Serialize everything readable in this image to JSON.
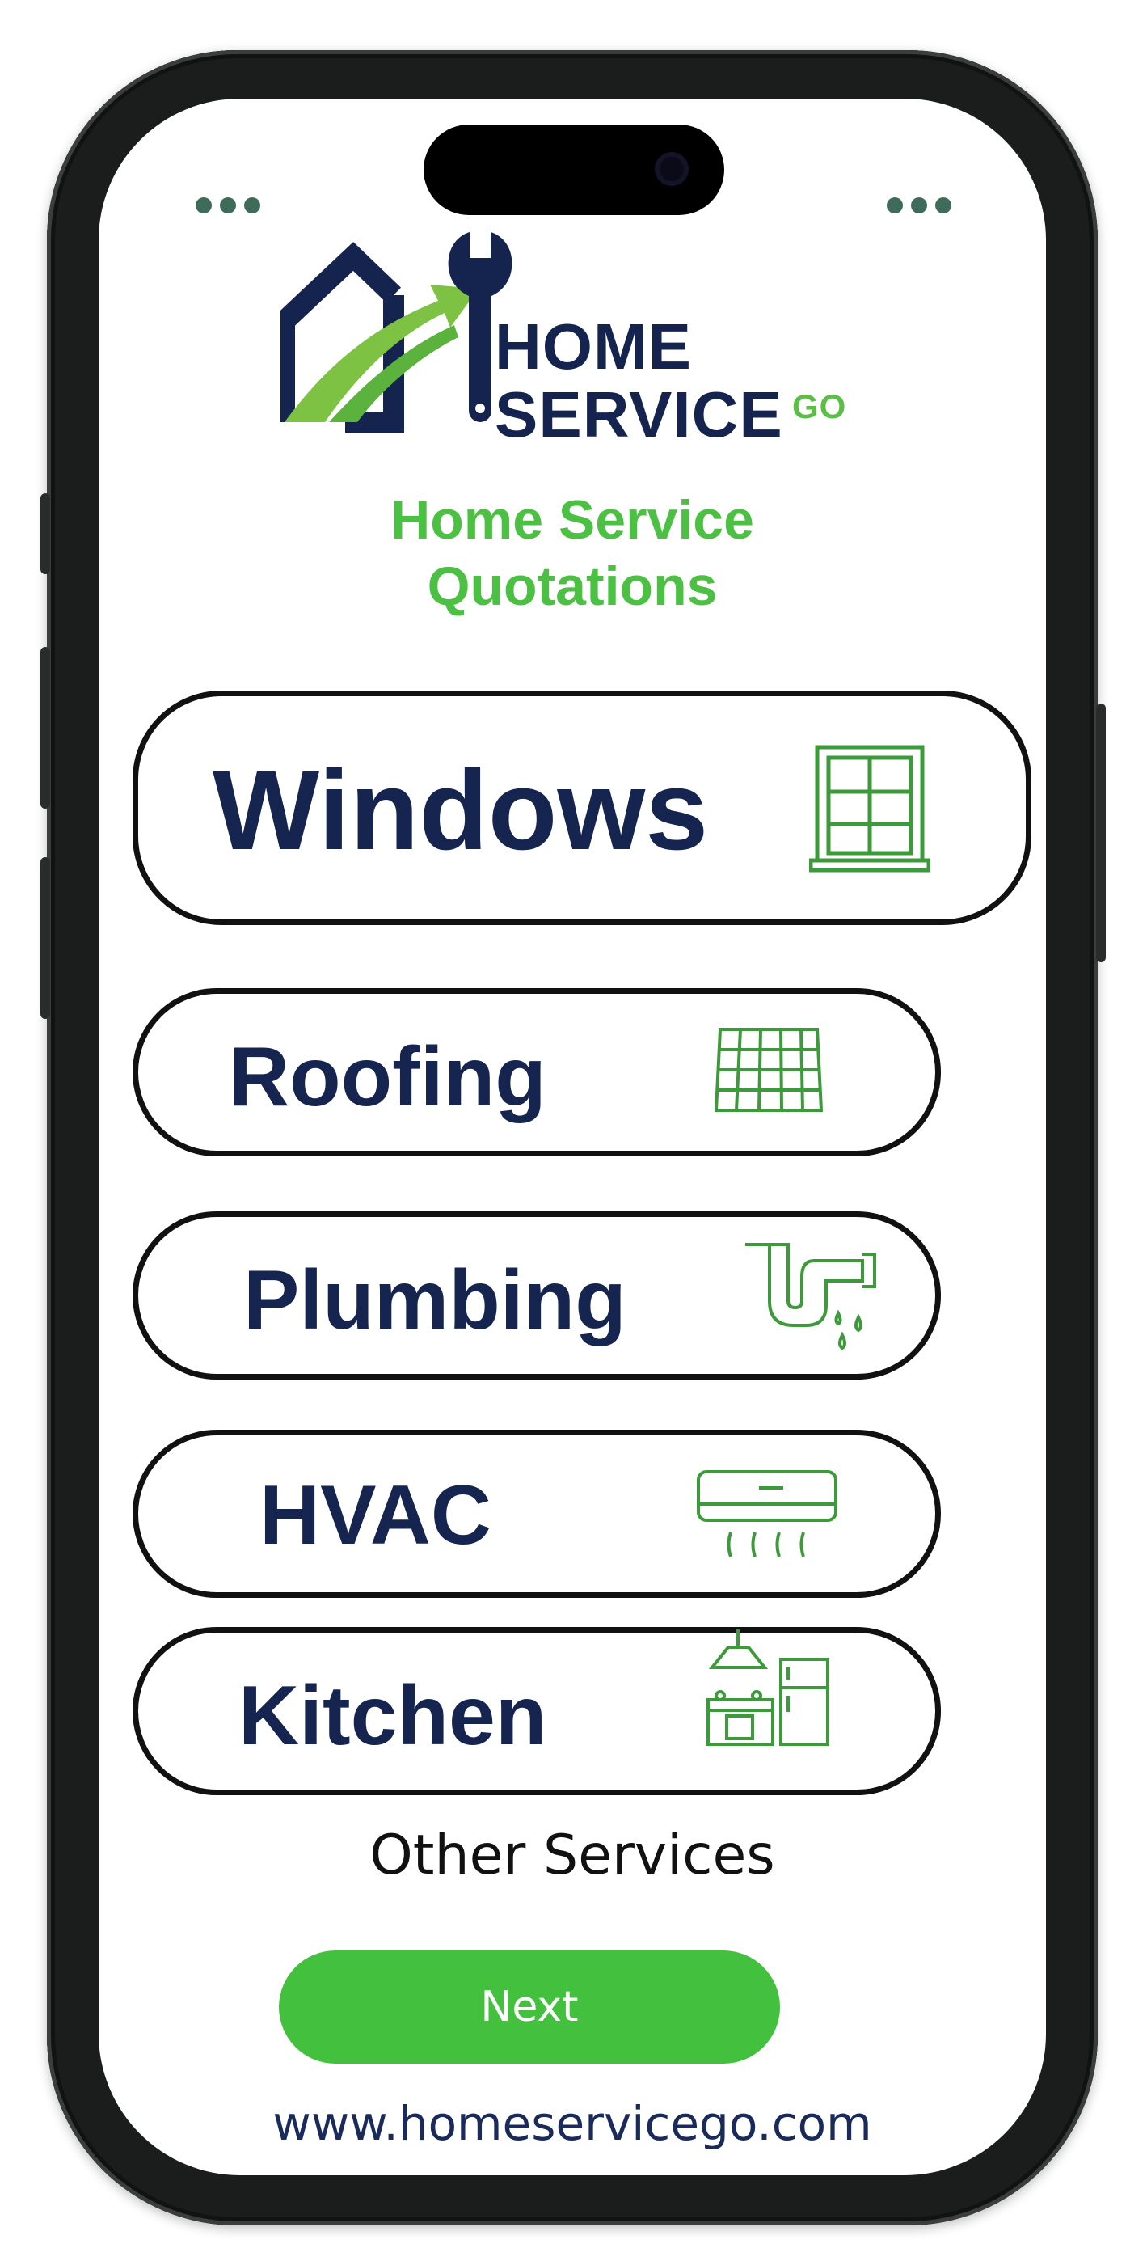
{
  "brand": {
    "line1": "HOME",
    "line2": "SERVICE",
    "suffix": "GO",
    "navy": "#14244f",
    "green": "#5bbf47"
  },
  "subtitle": {
    "line1": "Home Service",
    "line2": "Quotations"
  },
  "services": [
    {
      "label": "Windows",
      "icon": "window-icon"
    },
    {
      "label": "Roofing",
      "icon": "roof-tiles-icon"
    },
    {
      "label": "Plumbing",
      "icon": "pipe-leak-icon"
    },
    {
      "label": "HVAC",
      "icon": "air-conditioner-icon"
    },
    {
      "label": "Kitchen",
      "icon": "kitchen-appliances-icon"
    }
  ],
  "other_services": "Other Services",
  "next_label": "Next",
  "website": "www.homeservicego.com",
  "colors": {
    "accent_green": "#44c03f",
    "label_navy": "#16254f",
    "icon_green": "#3d9a3a"
  }
}
